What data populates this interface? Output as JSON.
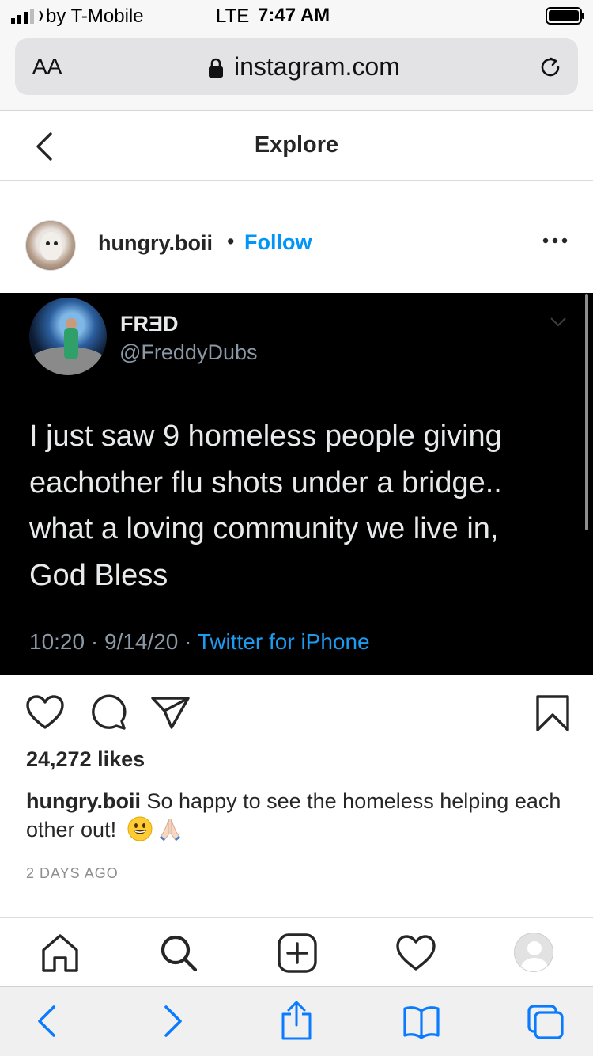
{
  "status_bar": {
    "carrier": "by T-Mobile",
    "network": "LTE",
    "time": "7:47 AM"
  },
  "address_bar": {
    "text_size": "AA",
    "domain": "instagram.com"
  },
  "header": {
    "title": "Explore"
  },
  "post": {
    "username": "hungry.boii",
    "separator": "•",
    "follow_label": "Follow",
    "tweet": {
      "name": "FRƎD",
      "handle": "@FreddyDubs",
      "text": "I just saw 9 homeless people giving eachother flu shots under a bridge.. what a loving community we live in, God Bless",
      "meta": "10:20 · 9/14/20 · ",
      "source": "Twitter for iPhone"
    },
    "likes": "24,272 likes",
    "caption_user": "hungry.boii",
    "caption_text": "So happy to see the homeless helping each other out!",
    "time_ago": "2 DAYS AGO"
  },
  "colors": {
    "accent": "#0095f6",
    "twitter_blue": "#1d9bf0",
    "safari_blue": "#0a7aff"
  },
  "icons": [
    "back-chevron-icon",
    "more-icon",
    "heart-icon",
    "comment-icon",
    "share-icon",
    "bookmark-icon",
    "home-icon",
    "search-icon",
    "add-icon",
    "activity-icon",
    "profile-icon"
  ]
}
